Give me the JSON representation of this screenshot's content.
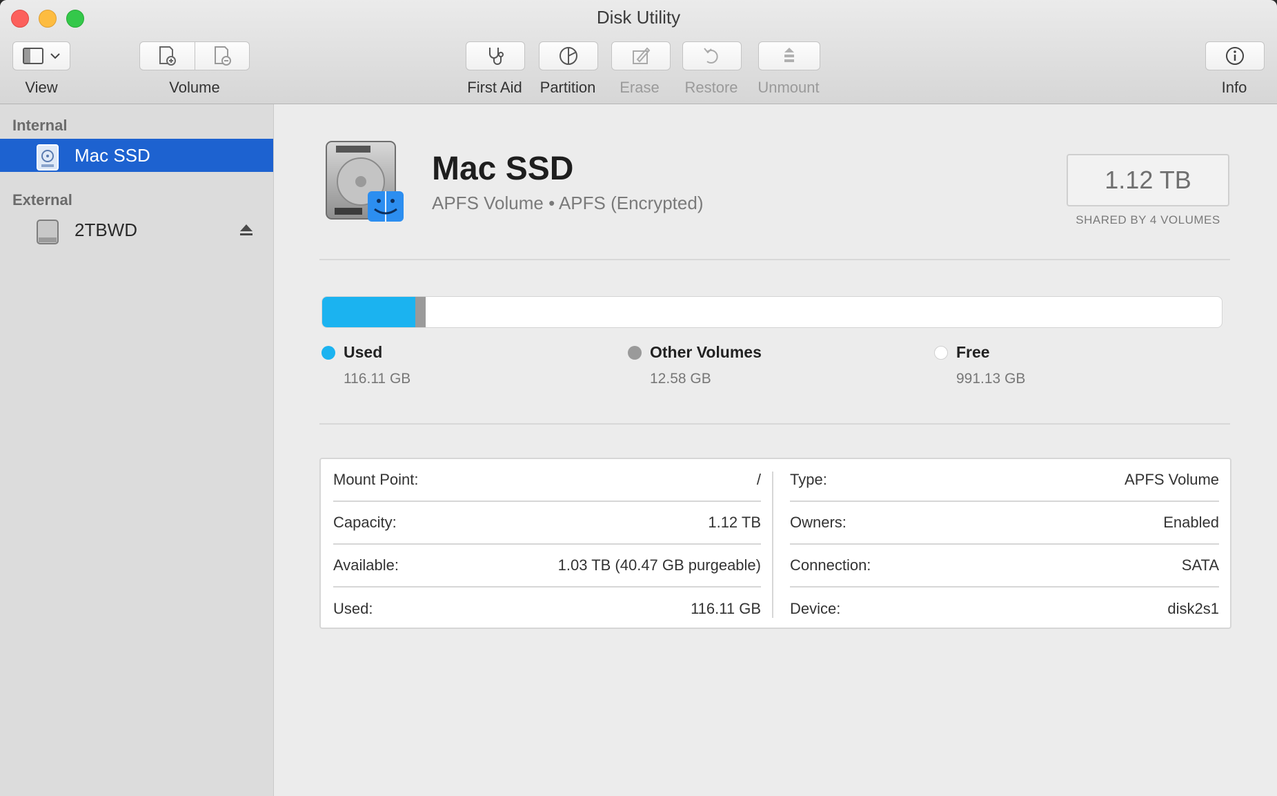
{
  "window": {
    "title": "Disk Utility"
  },
  "toolbar": {
    "view_label": "View",
    "volume_label": "Volume",
    "first_aid_label": "First Aid",
    "partition_label": "Partition",
    "erase_label": "Erase",
    "restore_label": "Restore",
    "unmount_label": "Unmount",
    "info_label": "Info"
  },
  "sidebar": {
    "internal_header": "Internal",
    "external_header": "External",
    "items": [
      {
        "label": "Mac SSD",
        "selected": true,
        "icon": "internal-disk-icon"
      },
      {
        "label": "2TBWD",
        "selected": false,
        "icon": "external-disk-icon",
        "ejectable": true
      }
    ]
  },
  "volume": {
    "name": "Mac SSD",
    "subtitle": "APFS Volume • APFS (Encrypted)",
    "capacity": "1.12 TB",
    "capacity_note": "SHARED BY 4 VOLUMES"
  },
  "usage": {
    "used": {
      "label": "Used",
      "value": "116.11 GB",
      "gb": 116.11,
      "color": "#1bb3f0"
    },
    "other": {
      "label": "Other Volumes",
      "value": "12.58 GB",
      "gb": 12.58,
      "color": "#9a9a9a"
    },
    "free": {
      "label": "Free",
      "value": "991.13 GB",
      "gb": 991.13,
      "color": "#ffffff"
    }
  },
  "details": {
    "left": [
      {
        "key": "Mount Point:",
        "value": "/"
      },
      {
        "key": "Capacity:",
        "value": "1.12 TB"
      },
      {
        "key": "Available:",
        "value": "1.03 TB (40.47 GB purgeable)"
      },
      {
        "key": "Used:",
        "value": "116.11 GB"
      }
    ],
    "right": [
      {
        "key": "Type:",
        "value": "APFS Volume"
      },
      {
        "key": "Owners:",
        "value": "Enabled"
      },
      {
        "key": "Connection:",
        "value": "SATA"
      },
      {
        "key": "Device:",
        "value": "disk2s1"
      }
    ]
  }
}
